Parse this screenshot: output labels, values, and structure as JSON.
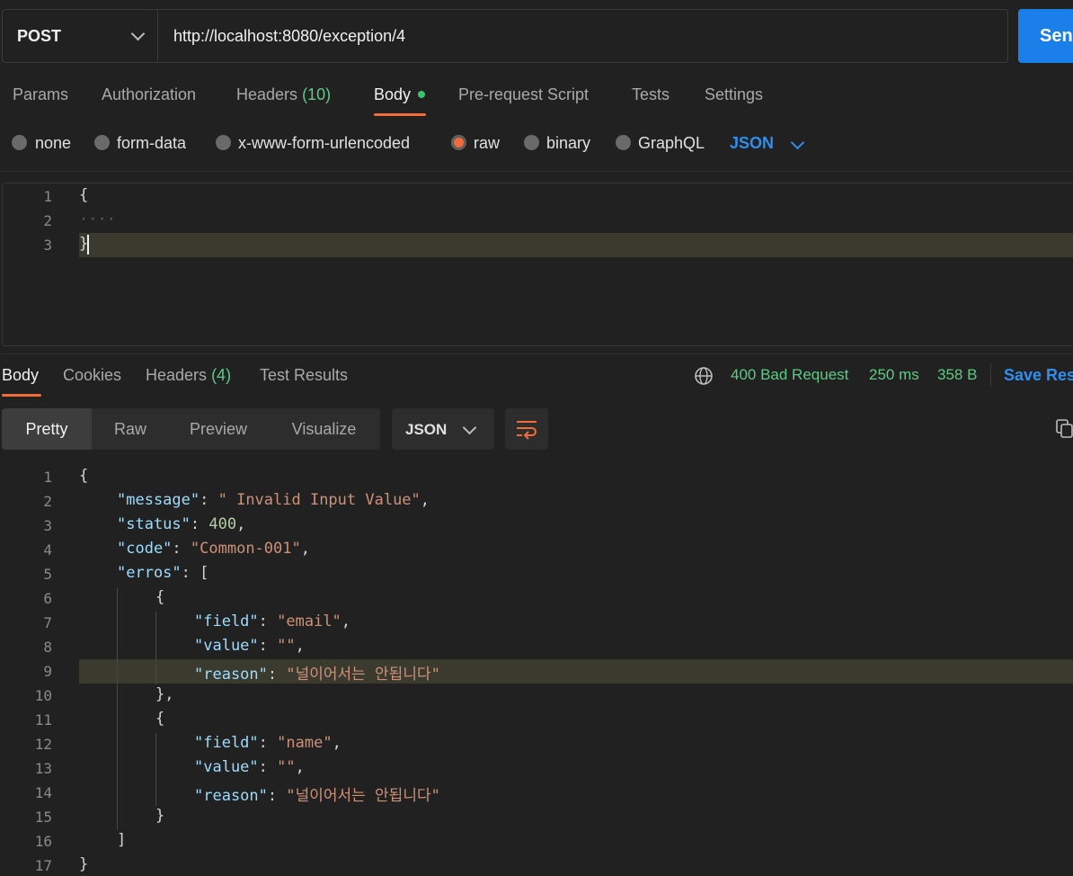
{
  "request": {
    "method": "POST",
    "url": "http://localhost:8080/exception/4",
    "send_label": "Sen"
  },
  "request_tabs": [
    {
      "label": "Params"
    },
    {
      "label": "Authorization"
    },
    {
      "label": "Headers",
      "count": "(10)"
    },
    {
      "label": "Body",
      "active": true
    },
    {
      "label": "Pre-request Script"
    },
    {
      "label": "Tests"
    },
    {
      "label": "Settings"
    }
  ],
  "body_types": [
    "none",
    "form-data",
    "x-www-form-urlencoded",
    "raw",
    "binary",
    "GraphQL"
  ],
  "body_type_selected": "raw",
  "body_format": "JSON",
  "request_body": {
    "line_numbers": [
      "1",
      "2",
      "3"
    ],
    "lines": [
      "{",
      "····",
      "}"
    ]
  },
  "response_tabs": [
    {
      "label": "Body",
      "active": true
    },
    {
      "label": "Cookies"
    },
    {
      "label": "Headers",
      "count": "(4)"
    },
    {
      "label": "Test Results"
    }
  ],
  "response_status": {
    "status": "400 Bad Request",
    "time": "250 ms",
    "size": "358 B",
    "save_label": "Save Res"
  },
  "view_modes": [
    "Pretty",
    "Raw",
    "Preview",
    "Visualize"
  ],
  "view_mode_active": "Pretty",
  "response_format": "JSON",
  "response_body": {
    "line_numbers": [
      "1",
      "2",
      "3",
      "4",
      "5",
      "6",
      "7",
      "8",
      "9",
      "10",
      "11",
      "12",
      "13",
      "14",
      "15",
      "16",
      "17"
    ],
    "message_key": "\"message\"",
    "message_value": "\" Invalid Input Value\"",
    "status_key": "\"status\"",
    "status_value": "400",
    "code_key": "\"code\"",
    "code_value": "\"Common-001\"",
    "errors_key": "\"erros\"",
    "field_key": "\"field\"",
    "value_key": "\"value\"",
    "reason_key": "\"reason\"",
    "error1_field": "\"email\"",
    "error1_value": "\"\"",
    "error1_reason": "\"널이어서는 안됩니다\"",
    "error2_field": "\"name\"",
    "error2_value": "\"\"",
    "error2_reason": "\"널이어서는 안됩니다\""
  },
  "icons": [
    "chevron-down-icon",
    "globe-icon",
    "wrap-lines-icon",
    "copy-icon"
  ]
}
